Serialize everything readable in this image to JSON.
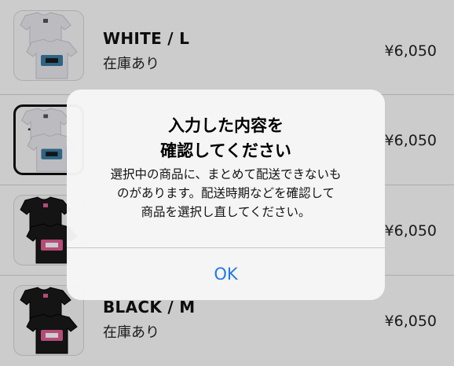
{
  "items": [
    {
      "variant": "WHITE / L",
      "stock": "在庫あり",
      "price": "¥6,050",
      "shirt_color": "#ebebf0",
      "print_color": "#3a7fa6"
    },
    {
      "variant": "",
      "stock": "",
      "price": "¥6,050",
      "shirt_color": "#ebebf0",
      "print_color": "#3a7fa6"
    },
    {
      "variant": "",
      "stock": "",
      "price": "¥6,050",
      "shirt_color": "#1a1a1a",
      "print_color": "#e45e96"
    },
    {
      "variant": "BLACK / M",
      "stock": "在庫あり",
      "price": "¥6,050",
      "shirt_color": "#1a1a1a",
      "print_color": "#e45e96"
    }
  ],
  "alert": {
    "title_line1": "入力した内容を",
    "title_line2": "確認してください",
    "message_line1": "選択中の商品に、まとめて配送できないも",
    "message_line2": "のがあります。配送時期などを確認して",
    "message_line3": "商品を選択し直してください。",
    "ok_label": "OK"
  },
  "colors": {
    "accent": "#1f7ae8",
    "dim": "rgba(0,0,0,0.20)"
  }
}
